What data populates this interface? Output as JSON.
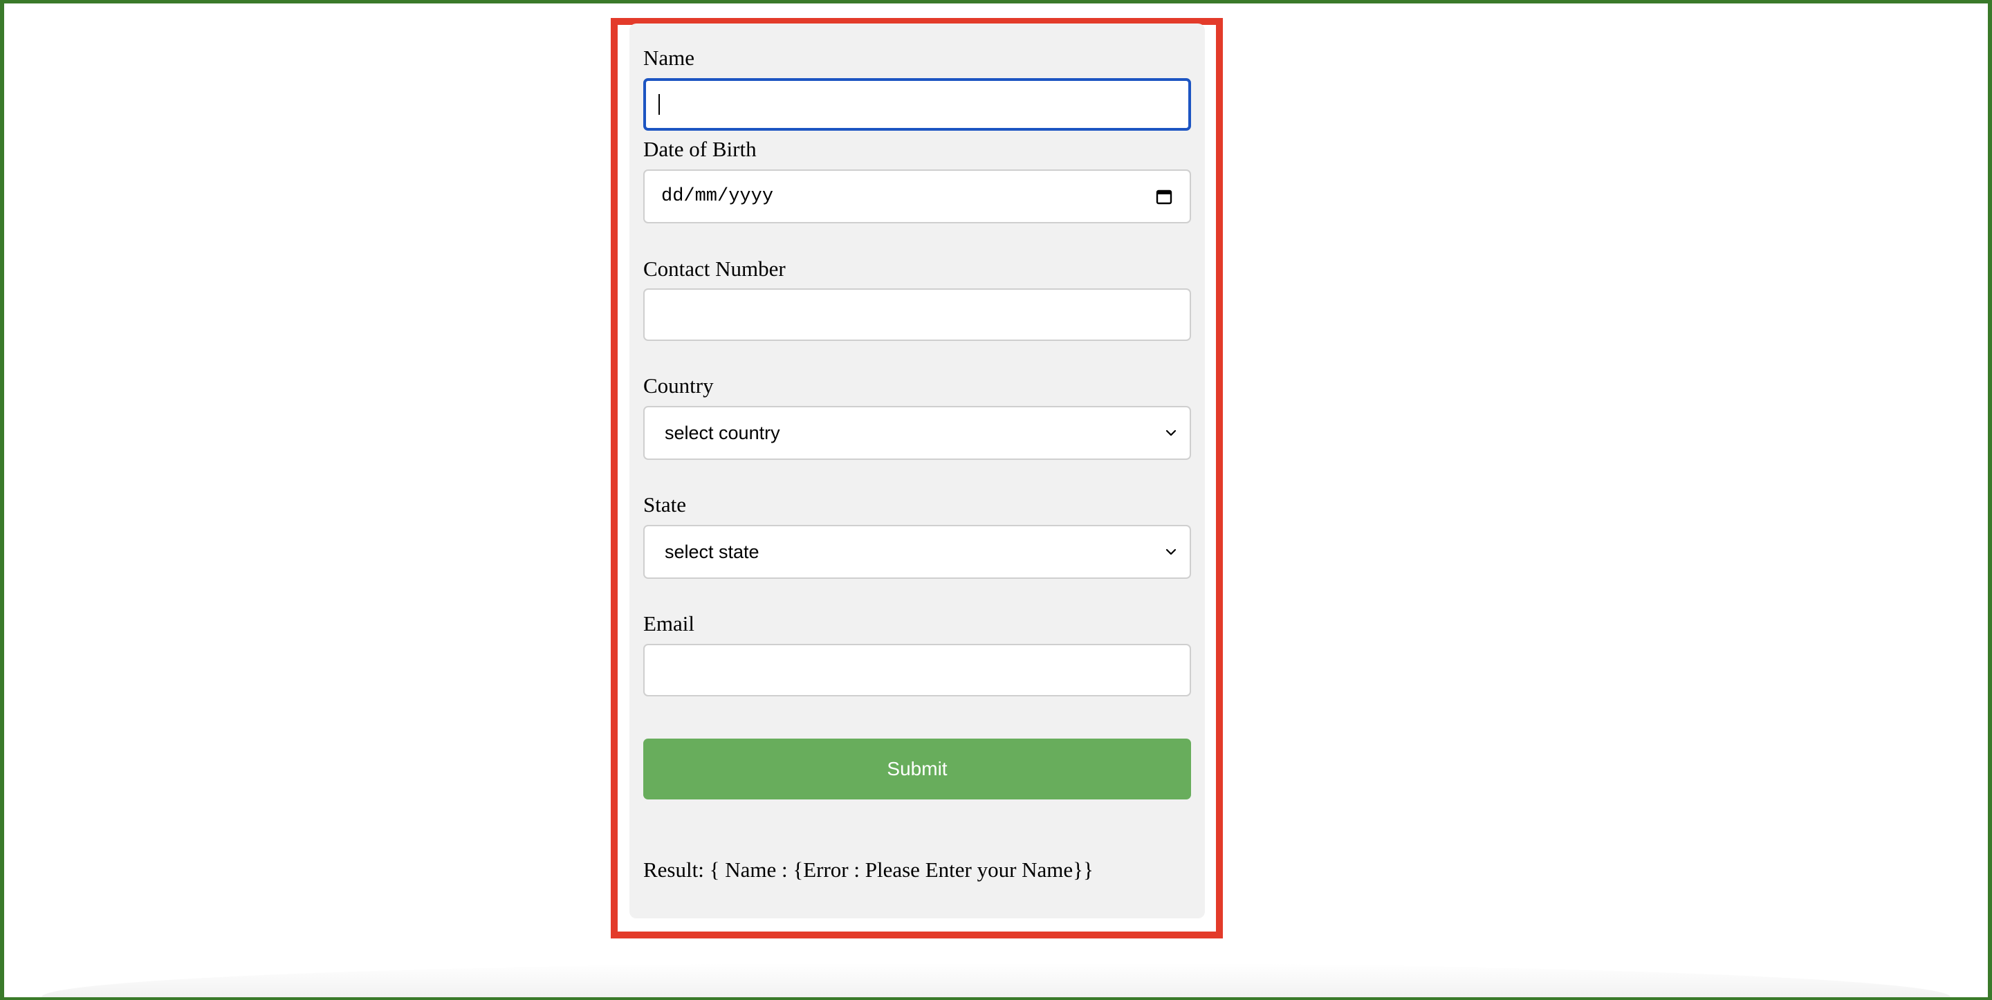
{
  "form": {
    "name": {
      "label": "Name",
      "value": ""
    },
    "dob": {
      "label": "Date of Birth",
      "placeholder": "dd/mm/yyyy"
    },
    "contact": {
      "label": "Contact Number",
      "value": ""
    },
    "country": {
      "label": "Country",
      "selected": "select country"
    },
    "state": {
      "label": "State",
      "selected": "select state"
    },
    "email": {
      "label": "Email",
      "value": ""
    },
    "submit_label": "Submit",
    "result": "Result: { Name : {Error : Please Enter your Name}}"
  },
  "icons": {
    "date_picker": "calendar-icon",
    "dropdown": "chevron-down-icon"
  },
  "colors": {
    "page_border": "#3a7a2a",
    "highlight_border": "#e33b2a",
    "card_background": "#f1f1f1",
    "focus_border": "#1d55c2",
    "submit_background": "#68ad5c"
  }
}
